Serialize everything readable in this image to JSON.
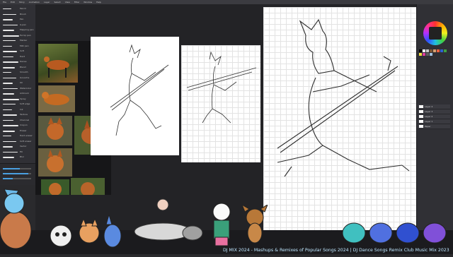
{
  "menu": {
    "items": [
      "File",
      "Edit",
      "Story",
      "Animation",
      "Layer",
      "Select",
      "View",
      "Filter",
      "Window",
      "Help"
    ]
  },
  "brush_panel": {
    "items": [
      {
        "label": "Pencil"
      },
      {
        "label": "Brush"
      },
      {
        "label": "Pen"
      },
      {
        "label": "G-pen"
      },
      {
        "label": "Mapping pen"
      },
      {
        "label": "Turnip pen"
      },
      {
        "label": "Marker"
      },
      {
        "label": "Milli pen"
      },
      {
        "label": "Soft"
      },
      {
        "label": "Hard"
      },
      {
        "label": "Dense"
      },
      {
        "label": "Blend"
      },
      {
        "label": "Smooth"
      },
      {
        "label": "Gouache"
      },
      {
        "label": "Oil"
      },
      {
        "label": "Watercolor"
      },
      {
        "label": "Airbrush"
      },
      {
        "label": "Spray"
      },
      {
        "label": "Soft edge"
      },
      {
        "label": "Ink"
      },
      {
        "label": "Texture"
      },
      {
        "label": "Charcoal"
      },
      {
        "label": "Crayon"
      },
      {
        "label": "Eraser"
      },
      {
        "label": "Hard eraser"
      },
      {
        "label": "Soft eraser"
      },
      {
        "label": "Vector"
      },
      {
        "label": "Fill"
      },
      {
        "label": "Blur"
      }
    ]
  },
  "layers": {
    "items": [
      {
        "label": "Layer 4"
      },
      {
        "label": "Layer 3"
      },
      {
        "label": "Layer 2"
      },
      {
        "label": "Layer 1"
      },
      {
        "label": "Paper"
      }
    ]
  },
  "colors": {
    "accent": "#4aa0e0",
    "swatches": [
      "#000000",
      "#ffffff",
      "#c8c8c8",
      "#7a5230",
      "#d8a070",
      "#e86040",
      "#3060d0",
      "#40a040",
      "#f0e040",
      "#e040a0",
      "#606060",
      "#a0c0e0"
    ]
  },
  "ticker": {
    "text": "DJ MIX 2024 - Mashups & Remixes of Popular Songs 2024 | DJ Dance Songs Remix Club Music Mix 2023"
  }
}
